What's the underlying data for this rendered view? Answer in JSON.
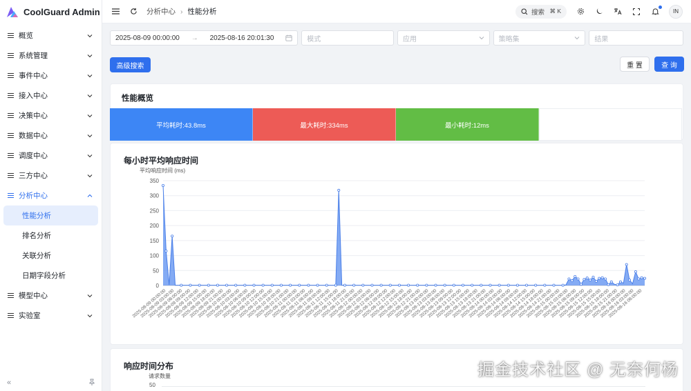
{
  "brand": {
    "name": "CoolGuard Admin",
    "logo_colors": [
      "#7b5cf5",
      "#4aa8ff",
      "#f062a8"
    ]
  },
  "sidebar": {
    "menu": [
      {
        "id": "overview",
        "label": "概览",
        "expanded": false
      },
      {
        "id": "system",
        "label": "系统管理",
        "expanded": false
      },
      {
        "id": "event",
        "label": "事件中心",
        "expanded": false
      },
      {
        "id": "access",
        "label": "接入中心",
        "expanded": false
      },
      {
        "id": "decision",
        "label": "决策中心",
        "expanded": false
      },
      {
        "id": "data",
        "label": "数据中心",
        "expanded": false
      },
      {
        "id": "schedule",
        "label": "调度中心",
        "expanded": false
      },
      {
        "id": "thirdparty",
        "label": "三方中心",
        "expanded": false
      },
      {
        "id": "analysis",
        "label": "分析中心",
        "expanded": true,
        "active": true,
        "children": [
          {
            "id": "perf",
            "label": "性能分析",
            "selected": true
          },
          {
            "id": "rank",
            "label": "排名分析"
          },
          {
            "id": "corr",
            "label": "关联分析"
          },
          {
            "id": "datefield",
            "label": "日期字段分析"
          }
        ]
      },
      {
        "id": "model",
        "label": "模型中心",
        "expanded": false
      },
      {
        "id": "lab",
        "label": "实验室",
        "expanded": false
      }
    ],
    "collapse_icon": "«",
    "pin_icon": "pin-icon"
  },
  "header": {
    "breadcrumb": [
      "分析中心",
      "性能分析"
    ],
    "search_label": "搜索",
    "search_shortcut": "⌘ K",
    "avatar_initials": "IN"
  },
  "filters": {
    "start": "2025-08-09 00:00:00",
    "end": "2025-08-16 20:01:30",
    "mode_placeholder": "模式",
    "app_placeholder": "应用",
    "policy_placeholder": "策略集",
    "result_placeholder": "结果",
    "advanced_label": "高级搜索",
    "reset_label": "重 置",
    "query_label": "查 询"
  },
  "overview": {
    "title": "性能概览",
    "stats": [
      {
        "label": "平均耗时:43.8ms",
        "color": "#3d86f5"
      },
      {
        "label": "最大耗时:334ms",
        "color": "#ed5b56"
      },
      {
        "label": "最小耗时:12ms",
        "color": "#62bd45"
      },
      {
        "label": "",
        "color": "#ffffff"
      }
    ]
  },
  "chart_data": [
    {
      "type": "area",
      "title": "每小时平均响应时间",
      "ylabel": "平均响应时间 (ms)",
      "ylim": [
        0,
        350
      ],
      "yticks": [
        0,
        50,
        100,
        150,
        200,
        250,
        300,
        350
      ],
      "color": "#5b8ff0",
      "grid": true,
      "x_labels": [
        "2025-08-09 00:00:00",
        "2025-08-09 03:00:00",
        "2025-08-09 06:00:00",
        "2025-08-09 09:00:00",
        "2025-08-09 12:00:00",
        "2025-08-09 15:00:00",
        "2025-08-09 18:00:00",
        "2025-08-09 21:00:00",
        "2025-08-10 00:00:00",
        "2025-08-10 03:00:00",
        "2025-08-10 06:00:00",
        "2025-08-10 09:00:00",
        "2025-08-10 12:00:00",
        "2025-08-10 15:00:00",
        "2025-08-10 18:00:00",
        "2025-08-10 21:00:00",
        "2025-08-11 00:00:00",
        "2025-08-11 03:00:00",
        "2025-08-11 06:00:00",
        "2025-08-11 09:00:00",
        "2025-08-11 12:00:00",
        "2025-08-11 15:00:00",
        "2025-08-11 18:00:00",
        "2025-08-11 21:00:00",
        "2025-08-12 00:00:00",
        "2025-08-12 03:00:00",
        "2025-08-12 06:00:00",
        "2025-08-12 09:00:00",
        "2025-08-12 12:00:00",
        "2025-08-12 15:00:00",
        "2025-08-12 18:00:00",
        "2025-08-12 21:00:00",
        "2025-08-13 00:00:00",
        "2025-08-13 03:00:00",
        "2025-08-13 06:00:00",
        "2025-08-13 09:00:00",
        "2025-08-13 12:00:00",
        "2025-08-13 15:00:00",
        "2025-08-13 18:00:00",
        "2025-08-13 21:00:00",
        "2025-08-14 00:00:00",
        "2025-08-14 03:00:00",
        "2025-08-14 06:00:00",
        "2025-08-14 09:00:00",
        "2025-08-14 12:00:00",
        "2025-08-14 15:00:00",
        "2025-08-14 18:00:00",
        "2025-08-14 21:00:00",
        "2025-08-15 00:00:00",
        "2025-08-15 03:00:00",
        "2025-08-15 06:00:00",
        "2025-08-15 09:00:00",
        "2025-08-15 12:00:00",
        "2025-08-15 15:00:00",
        "2025-08-15 18:00:00",
        "2025-08-15 21:00:00",
        "2025-08-16 00:00:00",
        "2025-08-16 03:00:00",
        "2025-08-16 06:00:00"
      ],
      "values": [
        334,
        115,
        2,
        165,
        2,
        1,
        1,
        1,
        1,
        1,
        1,
        1,
        1,
        1,
        1,
        1,
        1,
        1,
        1,
        1,
        1,
        1,
        1,
        1,
        1,
        1,
        1,
        1,
        1,
        1,
        1,
        1,
        1,
        1,
        1,
        1,
        1,
        1,
        1,
        1,
        1,
        1,
        1,
        1,
        1,
        1,
        1,
        1,
        1,
        1,
        1,
        1,
        1,
        1,
        1,
        1,
        1,
        1,
        1,
        1,
        1,
        1,
        1,
        1,
        1,
        1,
        1,
        1,
        318,
        2,
        1,
        1,
        1,
        1,
        1,
        1,
        1,
        1,
        1,
        1,
        1,
        1,
        1,
        1,
        1,
        1,
        1,
        1,
        1,
        1,
        1,
        1,
        1,
        1,
        1,
        1,
        1,
        1,
        1,
        1,
        1,
        1,
        1,
        1,
        1,
        1,
        1,
        1,
        1,
        1,
        1,
        1,
        1,
        1,
        1,
        1,
        1,
        1,
        1,
        1,
        1,
        1,
        1,
        1,
        1,
        1,
        1,
        1,
        1,
        1,
        1,
        1,
        1,
        1,
        1,
        1,
        1,
        1,
        1,
        1,
        1,
        1,
        1,
        1,
        1,
        1,
        1,
        1,
        1,
        1,
        1,
        1,
        1,
        1,
        1,
        1,
        1,
        1,
        1,
        1,
        1,
        1,
        1,
        1,
        1,
        1,
        1,
        1,
        1,
        1,
        1,
        1,
        1,
        1,
        1,
        1,
        1,
        1,
        1,
        1,
        1,
        1,
        1,
        1,
        1,
        1,
        1,
        1,
        1,
        1,
        1,
        1,
        1,
        1,
        1,
        1,
        1,
        1,
        1,
        1,
        1,
        1,
        1,
        1,
        1,
        1,
        1,
        1,
        1,
        1,
        1,
        1,
        1,
        1,
        1,
        1,
        1,
        1,
        1,
        1,
        1,
        1,
        1,
        1,
        1,
        1,
        1,
        1,
        1,
        1,
        1,
        1,
        1,
        1,
        1,
        1,
        1,
        1,
        1,
        1,
        1,
        1,
        1,
        1,
        1,
        1,
        1,
        1,
        1,
        1,
        1,
        1,
        1,
        1,
        1,
        1,
        1,
        1,
        1,
        1,
        1,
        1,
        1,
        1,
        1,
        1,
        1,
        1,
        1,
        1,
        1,
        1,
        1,
        1,
        1,
        1,
        1,
        1,
        1,
        1,
        1,
        1,
        1,
        1,
        1,
        1,
        1,
        1,
        1,
        1,
        1,
        1,
        1,
        1,
        1,
        1,
        1,
        1,
        1,
        1,
        1,
        1,
        1,
        1,
        1,
        1,
        1,
        1,
        1,
        1,
        1,
        1,
        1,
        1,
        1,
        1,
        1,
        1,
        1,
        1,
        1,
        1,
        1,
        1,
        1,
        1,
        1,
        1,
        1,
        1,
        1,
        1,
        1,
        1,
        1,
        1,
        1,
        1,
        1,
        1,
        1,
        1,
        1,
        1,
        1,
        1,
        1,
        1,
        1,
        1,
        1,
        1,
        1,
        1,
        1,
        1,
        1,
        1,
        1,
        1,
        1,
        1,
        1,
        1,
        1,
        1,
        1,
        1,
        1,
        1,
        1,
        1,
        1,
        1,
        1,
        1,
        1,
        1,
        1,
        1,
        1,
        1,
        1,
        1,
        1,
        1,
        1,
        1,
        1,
        1,
        1,
        1,
        1,
        1,
        1,
        1,
        1,
        1,
        1,
        1,
        1,
        1,
        1,
        1,
        1,
        1,
        1,
        1,
        1,
        1,
        1,
        1,
        1,
        1,
        1,
        1,
        1,
        1,
        1,
        1,
        1,
        1,
        1,
        1,
        1,
        1,
        1,
        1,
        1,
        1,
        1,
        1,
        1,
        1,
        1,
        1,
        1,
        1,
        1,
        1,
        1,
        1,
        1,
        1,
        1,
        1,
        1,
        1,
        1,
        1,
        1,
        1,
        1,
        1,
        1,
        1,
        1,
        1,
        1,
        1,
        1,
        1,
        1,
        1,
        1,
        1,
        1,
        1,
        1,
        1,
        1,
        1,
        1,
        1,
        1,
        1,
        1,
        1,
        1,
        1,
        1,
        1,
        1,
        1,
        1,
        1,
        1,
        1,
        1,
        1,
        1,
        1,
        1,
        1,
        1,
        1,
        1,
        1,
        1,
        1,
        1,
        1,
        1,
        1,
        1,
        1,
        1,
        1,
        1,
        1,
        1,
        1,
        1,
        1,
        1,
        1,
        1,
        1,
        1,
        1,
        1,
        1,
        1,
        1,
        1,
        1,
        1,
        1,
        1,
        1,
        1,
        1,
        1,
        1,
        1,
        1,
        1,
        1,
        1,
        1,
        1,
        1,
        1,
        1,
        1,
        1,
        1,
        1,
        1,
        1,
        1,
        1,
        1,
        1,
        1,
        1,
        1,
        1,
        1,
        1,
        1,
        1,
        1,
        1,
        1,
        1,
        1,
        1,
        1,
        1,
        1,
        1,
        1,
        1,
        1,
        1,
        1,
        1,
        1,
        1,
        1,
        1,
        1,
        1,
        1,
        1,
        1,
        1,
        1,
        1,
        1,
        1,
        1,
        1,
        1,
        1,
        1,
        1,
        1,
        1,
        1,
        1,
        1,
        1,
        1,
        1,
        1,
        1,
        1,
        1,
        1,
        1,
        1,
        1,
        1,
        1,
        1,
        1,
        1,
        1,
        1,
        1,
        1,
        1,
        1,
        1,
        1,
        1,
        1,
        1,
        1,
        1,
        1,
        1,
        1,
        1,
        1,
        1,
        1,
        1,
        1,
        1,
        1,
        1,
        1,
        1,
        1,
        1,
        1,
        1,
        1,
        1,
        1,
        1,
        1,
        1,
        1,
        1,
        1,
        1,
        1,
        1,
        1,
        1,
        1,
        1,
        1,
        1,
        1,
        1,
        1,
        1,
        1,
        1,
        1,
        1,
        1,
        1,
        1,
        1,
        1,
        1,
        1,
        1,
        1,
        1,
        1,
        1,
        1,
        1,
        1,
        1,
        1,
        1,
        1,
        1,
        1,
        1,
        1,
        1,
        1,
        1,
        1,
        1,
        1,
        1,
        1,
        1,
        1,
        1,
        1,
        1,
        1,
        1,
        1,
        1,
        1,
        1,
        1,
        1,
        1,
        1,
        1,
        1,
        1,
        1,
        1,
        1,
        1,
        1,
        1,
        1,
        1,
        1,
        1,
        1,
        1,
        1,
        1,
        1,
        1,
        1,
        1,
        1,
        1,
        1,
        1,
        1,
        1,
        1,
        1,
        1,
        1,
        1,
        1,
        1,
        1,
        1,
        1,
        1,
        1,
        1,
        1,
        1,
        1,
        1,
        1,
        1,
        1,
        1,
        1,
        1,
        1,
        1,
        1,
        1,
        1,
        1,
        1,
        1,
        1,
        1,
        1,
        1,
        1,
        1,
        1,
        1,
        1,
        1,
        1,
        1,
        1,
        1,
        1,
        1,
        1,
        1,
        1,
        1,
        1,
        1,
        1,
        1,
        1,
        1,
        1,
        1,
        1,
        1,
        1,
        1,
        1,
        1,
        1,
        1,
        1,
        1,
        1,
        1,
        1,
        1,
        1,
        1,
        1,
        1,
        1,
        1,
        1,
        1,
        1,
        1,
        1,
        1,
        1,
        1,
        1,
        1,
        1,
        1,
        1,
        1,
        1,
        1,
        1,
        1,
        1,
        1,
        1,
        1,
        1,
        1,
        1,
        1,
        1,
        1,
        1,
        1,
        1,
        1,
        1,
        1,
        1,
        1,
        1,
        1,
        1,
        1,
        1,
        1,
        1,
        1,
        1,
        1,
        1,
        1,
        1,
        1,
        1,
        1,
        1,
        1,
        1,
        1,
        1,
        1,
        1,
        1,
        1,
        1,
        1,
        1,
        1,
        1,
        1,
        1,
        1,
        1,
        1,
        1,
        1,
        1,
        1,
        1,
        1,
        1,
        1,
        1,
        1,
        1,
        1,
        1,
        1,
        1,
        1,
        1,
        1,
        1,
        1,
        1,
        1,
        1,
        1,
        1,
        1,
        1,
        1,
        1,
        1,
        1,
        1,
        1,
        1,
        1,
        1,
        1,
        1,
        1,
        1,
        1,
        1,
        1,
        1,
        1,
        1,
        1,
        1,
        1,
        1,
        1,
        1,
        1,
        1,
        1,
        1,
        1,
        1,
        1,
        1,
        1,
        1,
        1,
        1,
        1,
        1,
        1,
        1,
        1,
        1,
        1,
        1,
        1,
        1,
        1,
        1,
        1,
        1,
        1,
        1,
        1,
        1,
        1,
        1,
        1,
        1,
        1,
        1,
        1,
        1,
        1,
        1,
        1,
        1,
        1,
        1,
        1,
        1,
        1,
        1,
        1,
        1,
        1,
        1,
        1,
        1,
        1,
        1,
        1,
        1,
        1,
        1,
        1,
        1,
        1,
        1,
        1,
        1,
        1,
        1,
        1
      ],
      "tail_values": [
        2,
        22,
        16,
        30,
        22,
        4,
        20,
        25,
        18,
        28,
        14,
        24,
        26,
        22,
        3,
        12,
        4,
        2,
        12,
        8,
        70,
        18,
        6,
        46,
        22,
        26,
        24
      ]
    },
    {
      "type": "bar",
      "title": "响应时间分布",
      "ylabel": "请求数量",
      "yticks_visible": [
        50
      ]
    }
  ],
  "watermark": "掘金技术社区 @ 无奈何杨"
}
